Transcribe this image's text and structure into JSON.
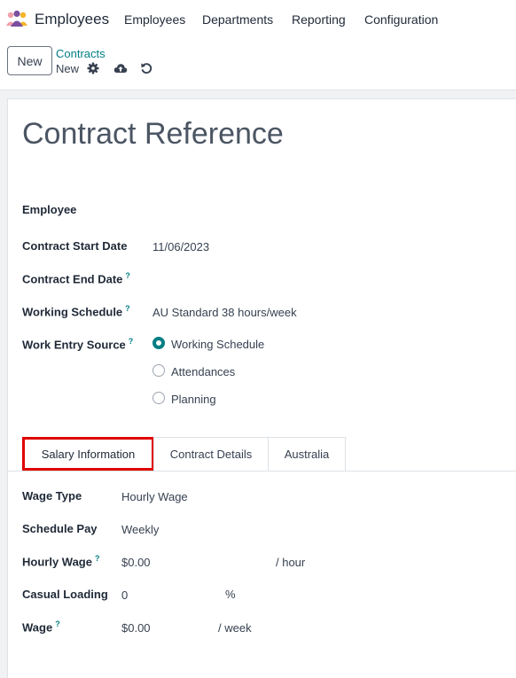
{
  "header": {
    "app_name": "Employees",
    "menu": [
      "Employees",
      "Departments",
      "Reporting",
      "Configuration"
    ]
  },
  "control": {
    "new_label": "New",
    "breadcrumb_parent": "Contracts",
    "breadcrumb_current": "New",
    "icons": [
      "gear-icon",
      "cloud-upload-icon",
      "discard-icon"
    ]
  },
  "form": {
    "title": "Contract Reference",
    "employee_label": "Employee",
    "employee_value": "",
    "start_date_label": "Contract Start Date",
    "start_date_value": "11/06/2023",
    "end_date_label": "Contract End Date",
    "end_date_value": "",
    "schedule_label": "Working Schedule",
    "schedule_value": "AU Standard 38 hours/week",
    "work_entry_label": "Work Entry Source",
    "work_entry_options": [
      "Working Schedule",
      "Attendances",
      "Planning"
    ],
    "work_entry_selected": "Working Schedule",
    "help_mark": "?"
  },
  "tabs": [
    "Salary Information",
    "Contract Details",
    "Australia"
  ],
  "active_tab": "Salary Information",
  "salary": {
    "wage_type_label": "Wage Type",
    "wage_type_value": "Hourly Wage",
    "schedule_pay_label": "Schedule Pay",
    "schedule_pay_value": "Weekly",
    "hourly_wage_label": "Hourly Wage",
    "hourly_wage_value": "$0.00",
    "hourly_wage_unit": "/ hour",
    "casual_loading_label": "Casual Loading",
    "casual_loading_value": "0",
    "casual_loading_unit": "%",
    "wage_label": "Wage",
    "wage_value": "$0.00",
    "wage_unit": "/ week"
  },
  "colors": {
    "accent": "#017e84",
    "highlight": "#e00000"
  }
}
